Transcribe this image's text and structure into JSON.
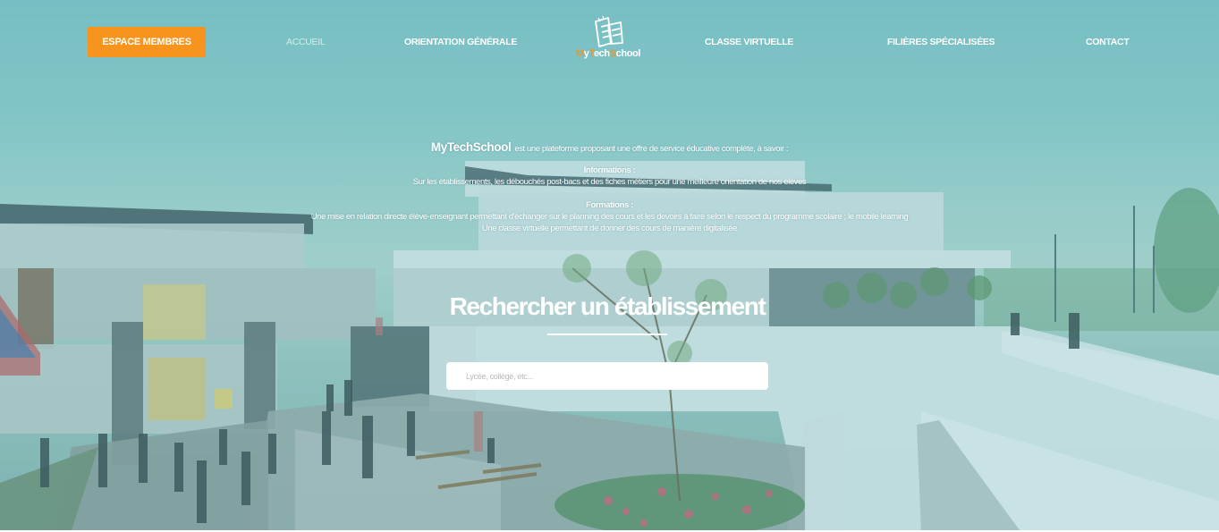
{
  "nav": {
    "members_button": "ESPACE MEMBRES",
    "links": {
      "home": "ACCUEIL",
      "orientation": "ORIENTATION GÉNÉRALE",
      "virtual_class": "CLASSE VIRTUELLE",
      "specialized": "FILIÈRES SPÉCIALISÉES",
      "contact": "CONTACT"
    }
  },
  "logo": {
    "icon": "books-icon",
    "text_parts": [
      "M",
      "y",
      "T",
      "ech",
      "S",
      "chool"
    ]
  },
  "intro": {
    "brand": "MyTechSchool",
    "brand_tail": "est une plateforme proposant une offre de service éducative complète, à savoir :",
    "info_title": "Informations :",
    "info_text": "Sur les établissements, les débouchés post-bacs et des fiches métiers pour une meilleure orientation de nos élèves",
    "training_title": "Formations :",
    "training_line1": "Une mise en relation directe élève-enseignant permettant d'échanger sur le planning des cours et les devoirs à faire selon le respect du programme scolaire ; le mobile learning",
    "training_line2": "Une classe virtuelle permettant de donner des cours de manière digitalisée"
  },
  "search": {
    "title": "Rechercher un établissement",
    "placeholder": "Lycée, collège, etc...",
    "value": ""
  },
  "colors": {
    "accent": "#f7941d",
    "overlay": "#60b2ba",
    "text": "#ffffff"
  }
}
